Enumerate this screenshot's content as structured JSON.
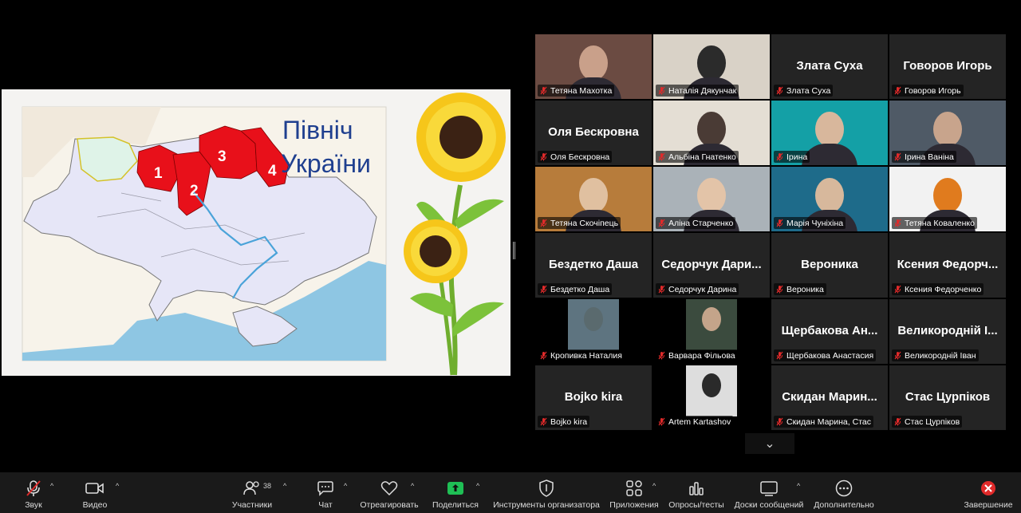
{
  "slide": {
    "title_line1": "Північ",
    "title_line2": "України",
    "regions": [
      "1",
      "2",
      "3",
      "4"
    ]
  },
  "participants": [
    {
      "label": "Тетяна Махотка",
      "video": true,
      "active": true
    },
    {
      "label": "Наталія Дякунчак",
      "video": true
    },
    {
      "label": "Злата Суха",
      "display": "Злата Суха"
    },
    {
      "label": "Говоров Игорь",
      "display": "Говоров Игорь"
    },
    {
      "label": "Оля Бескровна",
      "display": "Оля Бескровна"
    },
    {
      "label": "Альбіна Гнатенко",
      "video": true
    },
    {
      "label": "Ірина",
      "video": true
    },
    {
      "label": "Ірина Ваніна",
      "video": true
    },
    {
      "label": "Тетяна Скочіпець",
      "video": true
    },
    {
      "label": "Аліна Старченко",
      "video": true
    },
    {
      "label": "Марія Чуніхіна",
      "video": true
    },
    {
      "label": "Тетяна Коваленко",
      "video": true
    },
    {
      "label": "Бездетко Даша",
      "display": "Бездетко Даша"
    },
    {
      "label": "Седорчук Дарина",
      "display": "Седорчук Дари..."
    },
    {
      "label": "Вероника",
      "display": "Вероника"
    },
    {
      "label": "Ксения Федорченко",
      "display": "Ксения Федорч..."
    },
    {
      "label": "Кропивка Наталия",
      "video": true
    },
    {
      "label": "Варвара Фільова",
      "video": true
    },
    {
      "label": "Щербакова Анастасия",
      "display": "Щербакова Ан..."
    },
    {
      "label": "Великородній Іван",
      "display": "Великородній І..."
    },
    {
      "label": "Bojko kira",
      "display": "Bojko kira"
    },
    {
      "label": "Artem Kartashov",
      "video": true
    },
    {
      "label": "Скидан Марина, Стас",
      "display": "Скидан Марин..."
    },
    {
      "label": "Стас Цурпіков",
      "display": "Стас Цурпіков"
    }
  ],
  "toolbar": {
    "audio": "Звук",
    "video": "Видео",
    "participants": "Участники",
    "participants_count": "38",
    "chat": "Чат",
    "react": "Отреагировать",
    "share": "Поделиться",
    "host_tools": "Инструменты организатора",
    "apps": "Приложения",
    "polls": "Опросы/тесты",
    "whiteboards": "Доски сообщений",
    "more": "Дополнительно",
    "end": "Завершение"
  },
  "colors": {
    "active_speaker": "#2fd37a",
    "muted_icon": "#e02a2a",
    "share_green": "#1fbf55",
    "end_red": "#e02a2a",
    "region_red": "#e8101a"
  },
  "icons": {
    "expand": "chevron-down-icon"
  }
}
